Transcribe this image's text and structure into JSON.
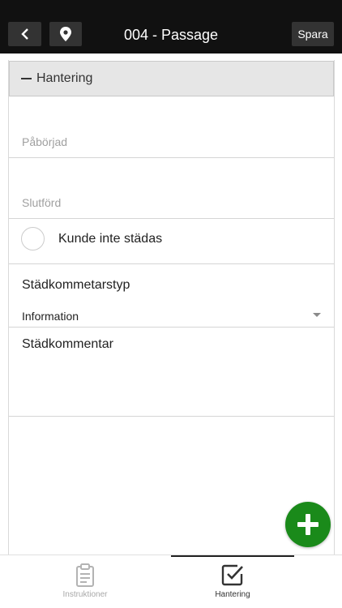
{
  "header": {
    "title": "004 - Passage",
    "save_label": "Spara",
    "back_icon": "chevron-left-icon",
    "location_icon": "map-pin-icon",
    "background": "#111111"
  },
  "section": {
    "title": "Hantering",
    "collapse_icon": "minus-icon"
  },
  "form": {
    "started_placeholder": "Påbörjad",
    "finished_placeholder": "Slutförd",
    "could_not_clean_label": "Kunde inte städas",
    "comment_type_label": "Städkommetarstyp",
    "comment_type_value": "Information",
    "comment_label": "Städkommentar"
  },
  "fab": {
    "icon": "plus-icon",
    "color": "#1a8a1a"
  },
  "tabbar": {
    "tabs": [
      {
        "label": "Instruktioner",
        "icon": "clipboard-icon",
        "active": false
      },
      {
        "label": "Hantering",
        "icon": "checkbox-icon",
        "active": true
      }
    ]
  }
}
